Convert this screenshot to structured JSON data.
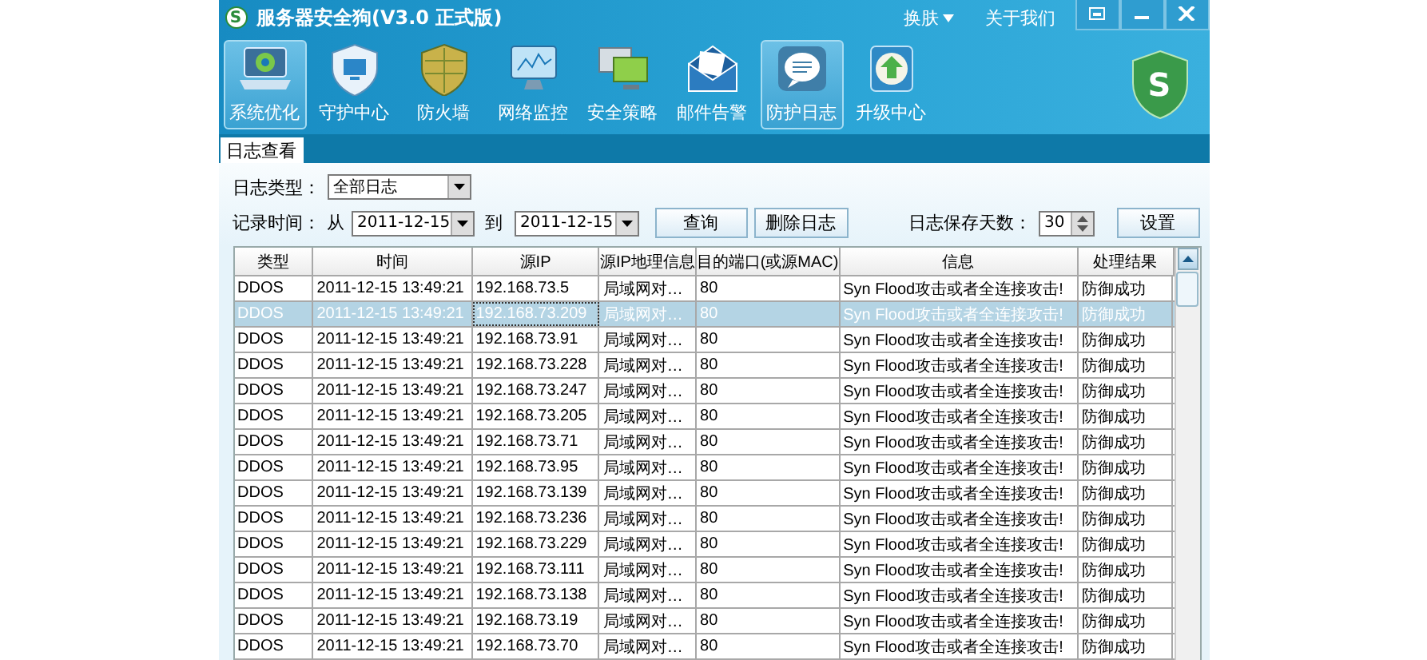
{
  "title_bar": {
    "logo_letter": "S",
    "title": "服务器安全狗(V3.0 正式版)",
    "skin_menu": "换肤",
    "about_link": "关于我们"
  },
  "toolbar": {
    "items": [
      {
        "label": "系统优化",
        "kind": "laptop",
        "selected": true
      },
      {
        "label": "守护中心",
        "kind": "shield-monitor",
        "selected": false
      },
      {
        "label": "防火墙",
        "kind": "shield",
        "selected": false
      },
      {
        "label": "网络监控",
        "kind": "monitor",
        "selected": false
      },
      {
        "label": "安全策略",
        "kind": "computers",
        "selected": false
      },
      {
        "label": "邮件告警",
        "kind": "envelope",
        "selected": false
      },
      {
        "label": "防护日志",
        "kind": "chat",
        "selected": true
      },
      {
        "label": "升级中心",
        "kind": "upload",
        "selected": false
      }
    ],
    "logo_letter": "S"
  },
  "tabs": [
    {
      "label": "日志查看",
      "selected": true
    }
  ],
  "filters": {
    "type_label": "日志类型：",
    "type_value": "全部日志",
    "time_label": "记录时间：",
    "from_label": "从",
    "from_value": "2011-12-15",
    "to_label": "到",
    "to_value": "2011-12-15",
    "query_button": "查询",
    "delete_button": "删除日志",
    "keep_days_label": "日志保存天数：",
    "keep_days_value": "30",
    "set_button": "设置"
  },
  "table": {
    "columns": [
      "类型",
      "时间",
      "源IP",
      "源IP地理信息",
      "目的端口(或源MAC)",
      "信息",
      "处理结果"
    ],
    "rows": [
      {
        "cells": [
          "DDOS",
          "2011-12-15 13:49:21",
          "192.168.73.5",
          "局域网对…",
          "80",
          "Syn Flood攻击或者全连接攻击!",
          "防御成功"
        ],
        "selected": false
      },
      {
        "cells": [
          "DDOS",
          "2011-12-15 13:49:21",
          "192.168.73.209",
          "局域网对…",
          "80",
          "Syn Flood攻击或者全连接攻击!",
          "防御成功"
        ],
        "selected": true
      },
      {
        "cells": [
          "DDOS",
          "2011-12-15 13:49:21",
          "192.168.73.91",
          "局域网对…",
          "80",
          "Syn Flood攻击或者全连接攻击!",
          "防御成功"
        ],
        "selected": false
      },
      {
        "cells": [
          "DDOS",
          "2011-12-15 13:49:21",
          "192.168.73.228",
          "局域网对…",
          "80",
          "Syn Flood攻击或者全连接攻击!",
          "防御成功"
        ],
        "selected": false
      },
      {
        "cells": [
          "DDOS",
          "2011-12-15 13:49:21",
          "192.168.73.247",
          "局域网对…",
          "80",
          "Syn Flood攻击或者全连接攻击!",
          "防御成功"
        ],
        "selected": false
      },
      {
        "cells": [
          "DDOS",
          "2011-12-15 13:49:21",
          "192.168.73.205",
          "局域网对…",
          "80",
          "Syn Flood攻击或者全连接攻击!",
          "防御成功"
        ],
        "selected": false
      },
      {
        "cells": [
          "DDOS",
          "2011-12-15 13:49:21",
          "192.168.73.71",
          "局域网对…",
          "80",
          "Syn Flood攻击或者全连接攻击!",
          "防御成功"
        ],
        "selected": false
      },
      {
        "cells": [
          "DDOS",
          "2011-12-15 13:49:21",
          "192.168.73.95",
          "局域网对…",
          "80",
          "Syn Flood攻击或者全连接攻击!",
          "防御成功"
        ],
        "selected": false
      },
      {
        "cells": [
          "DDOS",
          "2011-12-15 13:49:21",
          "192.168.73.139",
          "局域网对…",
          "80",
          "Syn Flood攻击或者全连接攻击!",
          "防御成功"
        ],
        "selected": false
      },
      {
        "cells": [
          "DDOS",
          "2011-12-15 13:49:21",
          "192.168.73.236",
          "局域网对…",
          "80",
          "Syn Flood攻击或者全连接攻击!",
          "防御成功"
        ],
        "selected": false
      },
      {
        "cells": [
          "DDOS",
          "2011-12-15 13:49:21",
          "192.168.73.229",
          "局域网对…",
          "80",
          "Syn Flood攻击或者全连接攻击!",
          "防御成功"
        ],
        "selected": false
      },
      {
        "cells": [
          "DDOS",
          "2011-12-15 13:49:21",
          "192.168.73.111",
          "局域网对…",
          "80",
          "Syn Flood攻击或者全连接攻击!",
          "防御成功"
        ],
        "selected": false
      },
      {
        "cells": [
          "DDOS",
          "2011-12-15 13:49:21",
          "192.168.73.138",
          "局域网对…",
          "80",
          "Syn Flood攻击或者全连接攻击!",
          "防御成功"
        ],
        "selected": false
      },
      {
        "cells": [
          "DDOS",
          "2011-12-15 13:49:21",
          "192.168.73.19",
          "局域网对…",
          "80",
          "Syn Flood攻击或者全连接攻击!",
          "防御成功"
        ],
        "selected": false
      },
      {
        "cells": [
          "DDOS",
          "2011-12-15 13:49:21",
          "192.168.73.70",
          "局域网对…",
          "80",
          "Syn Flood攻击或者全连接攻击!",
          "防御成功"
        ],
        "selected": false
      }
    ]
  }
}
